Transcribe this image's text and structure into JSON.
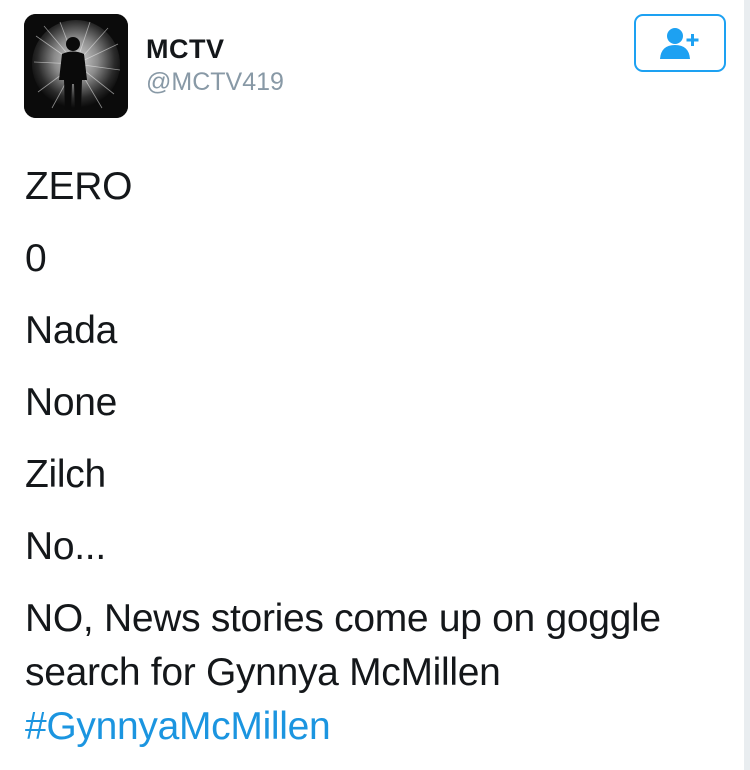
{
  "tweet": {
    "author": {
      "display_name": "MCTV",
      "handle": "@MCTV419",
      "avatar_icon": "silhouette-avatar-icon"
    },
    "follow_icon": "add-user-icon",
    "lines": [
      "ZERO",
      "0",
      "Nada",
      "None",
      "Zilch",
      "No..."
    ],
    "paragraph_line1": "NO, News stories come up on goggle",
    "paragraph_line2": "search for Gynnya McMillen",
    "hashtag": "#GynnyaMcMillen"
  },
  "colors": {
    "accent": "#1da1f2",
    "hashtag": "#1b95e0",
    "handle": "#8899a6",
    "text": "#14171a"
  }
}
